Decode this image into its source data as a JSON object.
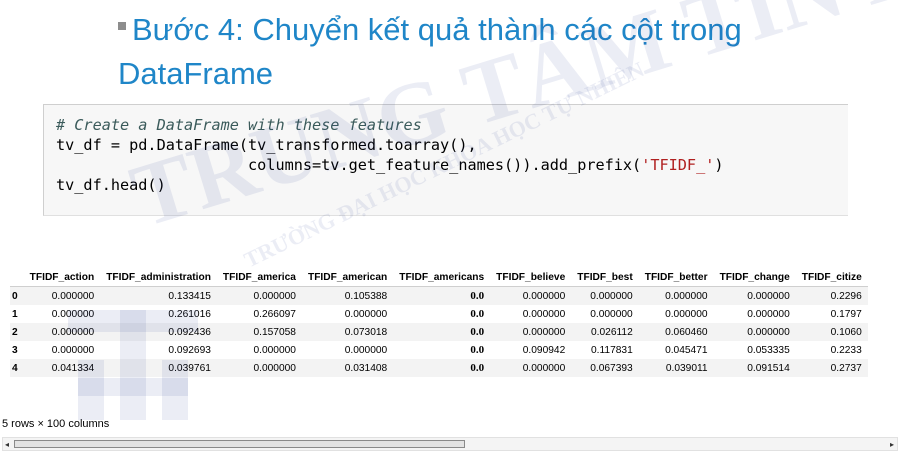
{
  "slide": {
    "title": "Bước 4: Chuyển kết quả thành các cột trong DataFrame"
  },
  "code": {
    "lines": [
      "# Create a DataFrame with these features",
      "tv_df = pd.DataFrame(tv_transformed.toarray(),",
      "                     columns=tv.get_feature_names()).add_prefix(",
      "'TFIDF_'",
      ")",
      "tv_df.head()"
    ]
  },
  "dataframe": {
    "columns": [
      "TFIDF_action",
      "TFIDF_administration",
      "TFIDF_america",
      "TFIDF_american",
      "TFIDF_americans",
      "TFIDF_believe",
      "TFIDF_best",
      "TFIDF_better",
      "TFIDF_change",
      "TFIDF_citize"
    ],
    "rows": [
      {
        "index": "0",
        "values": [
          "0.000000",
          "0.133415",
          "0.000000",
          "0.105388",
          "0.0",
          "0.000000",
          "0.000000",
          "0.000000",
          "0.000000",
          "0.2296"
        ]
      },
      {
        "index": "1",
        "values": [
          "0.000000",
          "0.261016",
          "0.266097",
          "0.000000",
          "0.0",
          "0.000000",
          "0.000000",
          "0.000000",
          "0.000000",
          "0.1797"
        ]
      },
      {
        "index": "2",
        "values": [
          "0.000000",
          "0.092436",
          "0.157058",
          "0.073018",
          "0.0",
          "0.000000",
          "0.026112",
          "0.060460",
          "0.000000",
          "0.1060"
        ]
      },
      {
        "index": "3",
        "values": [
          "0.000000",
          "0.092693",
          "0.000000",
          "0.000000",
          "0.0",
          "0.090942",
          "0.117831",
          "0.045471",
          "0.053335",
          "0.2233"
        ]
      },
      {
        "index": "4",
        "values": [
          "0.041334",
          "0.039761",
          "0.000000",
          "0.031408",
          "0.0",
          "0.000000",
          "0.067393",
          "0.039011",
          "0.091514",
          "0.2737"
        ]
      }
    ],
    "shape_note": "5 rows × 100 columns"
  },
  "scrollbar": {
    "left_arrow": "◂",
    "right_arrow": "▸",
    "thumb_fraction": 0.52
  },
  "watermark": {
    "line1": "TRUNG TÂM TIN HỌC",
    "line2": "TRƯỜNG ĐẠI HỌC KHOA HỌC TỰ NHIÊN"
  }
}
